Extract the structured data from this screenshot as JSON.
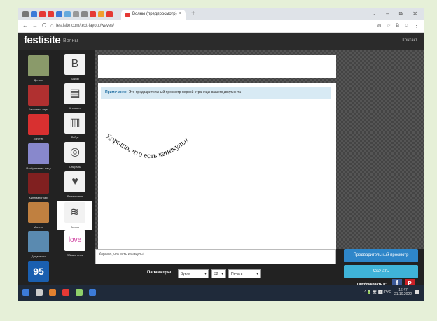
{
  "browser": {
    "tab_title": "Волны (предпросмотр)",
    "close": "×",
    "new_tab": "+",
    "url": "festisite.com/text-layout/waves/",
    "window_controls": [
      "⌄",
      "–",
      "⧉",
      "✕"
    ],
    "nav": [
      "←",
      "→",
      "C",
      "⌂"
    ],
    "addr_icons": [
      "⋒",
      "☆",
      "⧉",
      "☺",
      "⋮"
    ],
    "tab_icon_colors": [
      "#777",
      "#3c7bd8",
      "#e53935",
      "#e53935",
      "#3c7bd8",
      "#66aadd",
      "#999",
      "#888",
      "#e53935",
      "#f0a030",
      "#e53935"
    ]
  },
  "site": {
    "logo": "festisite",
    "nav_label": "Волны",
    "contact": "Контакт"
  },
  "sidebar": {
    "left_items": [
      {
        "label": "Деньги",
        "color": "#8a9a6a"
      },
      {
        "label": "Картотека игры",
        "color": "#b03030"
      },
      {
        "label": "Логотип",
        "color": "#d83030"
      },
      {
        "label": "Изображение лица",
        "color": "#8888cc"
      },
      {
        "label": "Кинематограф",
        "color": "#802020"
      },
      {
        "label": "Монеты",
        "color": "#c08040"
      },
      {
        "label": "Документы",
        "color": "#5a8ab0"
      },
      {
        "label": "",
        "color": "#1a5fb0",
        "text": "95"
      }
    ],
    "right_items": [
      {
        "label": "Буквы",
        "glyph": "B",
        "active": false
      },
      {
        "label": "Алфавит",
        "glyph": "▤",
        "active": false
      },
      {
        "label": "Ребус",
        "glyph": "▥",
        "active": false
      },
      {
        "label": "Спираль",
        "glyph": "◎",
        "active": false
      },
      {
        "label": "Валентинка",
        "glyph": "♥",
        "active": false
      },
      {
        "label": "Волны",
        "glyph": "≋",
        "active": true
      },
      {
        "label": "Облако слов",
        "glyph": "love",
        "active": false
      }
    ]
  },
  "editor": {
    "notice_bold": "Примечание!",
    "notice_text": " Это предварительный просмотр первой страницы вашего документа",
    "wavy_text": "Хорошо, что есть каникулы!",
    "text_input": "Хорошо, что есть каникулы!",
    "params_label": "Параметры",
    "font_select": "Вуели",
    "size_select": "32",
    "style_select": "Печать",
    "preview_button": "Предварительный просмотр",
    "download_button": "Скачать",
    "publish_label": "Опубликовать в:",
    "fb": "f",
    "pin": "P"
  },
  "taskbar": {
    "icon_colors": [
      "#3c7bd8",
      "#cccccc",
      "#e08030",
      "#e53935",
      "#8fd06a",
      "#3c7bd8"
    ],
    "tray": "^ 🔋 🖥 ◀) РУС",
    "time": "16:47",
    "date": "21.10.2022"
  }
}
